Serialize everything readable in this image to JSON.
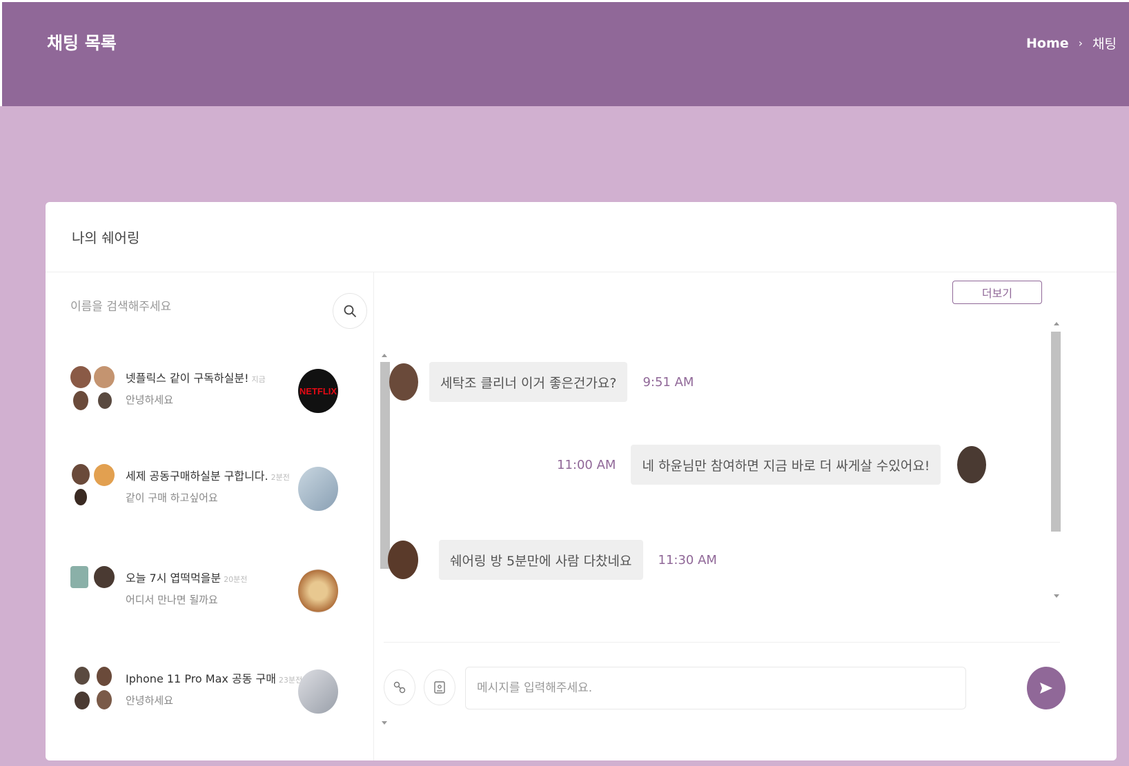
{
  "header": {
    "title": "채팅 목록",
    "breadcrumb": {
      "home": "Home",
      "separator": "›",
      "current": "채팅"
    }
  },
  "card": {
    "title": "나의 쉐어링"
  },
  "search": {
    "placeholder": "이름을 검색해주세요"
  },
  "chat_list": [
    {
      "title": "넷플릭스 같이 구독하실분!",
      "time": "지금",
      "subtitle": "안녕하세요",
      "thumb_icon": "netflix-logo",
      "thumb_text": "NETFLIX"
    },
    {
      "title": "세제 공동구매하실분 구합니다.",
      "time": "2분전",
      "subtitle": "같이 구매 하고싶어요",
      "thumb_icon": "detergent-image"
    },
    {
      "title": "오늘 7시 엽떡먹을분",
      "time": "20분전",
      "subtitle": "어디서 만나면 될까요",
      "thumb_icon": "food-image"
    },
    {
      "title": "Iphone 11 Pro Max 공동 구매",
      "time": "23분전",
      "subtitle": "안녕하세요",
      "thumb_icon": "phone-image"
    }
  ],
  "messages_panel": {
    "more_label": "더보기",
    "messages": [
      {
        "text": "세탁조 클리너 이거 좋은건가요?",
        "time": "9:51 AM",
        "side": "left"
      },
      {
        "text": "네 하윤님만 참여하면 지금 바로 더 싸게살 수있어요!",
        "time": "11:00 AM",
        "side": "right"
      },
      {
        "text": "쉐어링 방 5분만에 사람 다찼네요",
        "time": "11:30 AM",
        "side": "left"
      }
    ]
  },
  "composer": {
    "placeholder": "메시지를 입력해주세요."
  },
  "colors": {
    "primary": "#906898",
    "background": "#d1b0d0",
    "bubble": "#efefef"
  }
}
